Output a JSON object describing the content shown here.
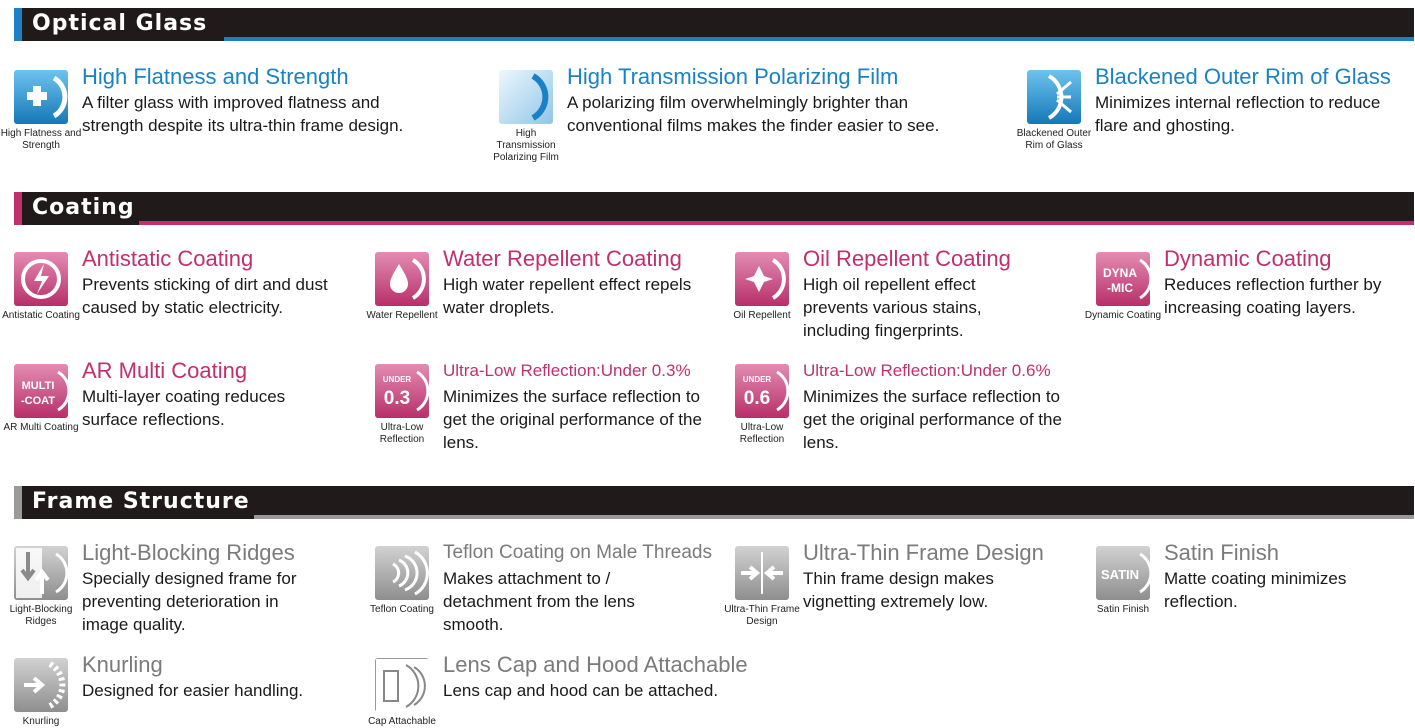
{
  "colors": {
    "blue": "#1a82c4",
    "pink": "#c0306e",
    "gray": "#7b7b7b",
    "bar": "#211a1a"
  },
  "sections": {
    "optical": {
      "title": "Optical Glass"
    },
    "coating": {
      "title": "Coating"
    },
    "frame": {
      "title": "Frame Structure"
    }
  },
  "optical_items": [
    {
      "icon": "cross-plus-icon",
      "caption": "High Flatness and Strength",
      "title": "High Flatness and Strength",
      "desc": "A filter glass with improved flatness and strength despite its ultra-thin frame design."
    },
    {
      "icon": "polarizing-film-icon",
      "caption": "High Transmission Polarizing Film",
      "title": "High Transmission Polarizing Film",
      "desc": "A polarizing film overwhelmingly brighter than conventional films makes the finder easier to see."
    },
    {
      "icon": "blackened-rim-icon",
      "caption": "Blackened Outer Rim of Glass",
      "title": "Blackened Outer Rim of Glass",
      "desc": "Minimizes internal reflection to reduce flare and ghosting."
    }
  ],
  "coating_items": [
    {
      "icon": "lightning-icon",
      "caption": "Antistatic Coating",
      "title": "Antistatic Coating",
      "desc": "Prevents sticking of dirt and dust caused by static electricity."
    },
    {
      "icon": "water-drop-icon",
      "caption": "Water Repellent",
      "title": "Water Repellent Coating",
      "desc": "High water repellent effect repels water droplets."
    },
    {
      "icon": "oil-drop-icon",
      "caption": "Oil Repellent",
      "title": "Oil Repellent Coating",
      "desc": "High oil repellent effect prevents various stains, including fingerprints."
    },
    {
      "icon": "dynamic-mic-icon",
      "icon_text": [
        "DYNA",
        "-MIC"
      ],
      "caption": "Dynamic Coating",
      "title": "Dynamic Coating",
      "desc": "Reduces reflection further by increasing coating layers."
    },
    {
      "icon": "multi-coat-icon",
      "icon_text": [
        "MULTI",
        "-COAT"
      ],
      "caption": "AR Multi Coating",
      "title": "AR Multi Coating",
      "desc": "Multi-layer coating reduces surface reflections."
    },
    {
      "icon": "under-03-icon",
      "icon_text": [
        "UNDER",
        "0.3"
      ],
      "caption": "Ultra-Low Reflection",
      "title": "Ultra-Low Reflection:Under 0.3%",
      "desc": "Minimizes the surface reflection to get the original performance of the lens."
    },
    {
      "icon": "under-06-icon",
      "icon_text": [
        "UNDER",
        "0.6"
      ],
      "caption": "Ultra-Low Reflection",
      "title": "Ultra-Low Reflection:Under 0.6%",
      "desc": "Minimizes the surface reflection to get the original performance of the lens."
    }
  ],
  "frame_items": [
    {
      "icon": "light-blocking-ridges-icon",
      "caption": "Light-Blocking Ridges",
      "title": "Light-Blocking Ridges",
      "desc": "Specially designed frame for preventing deterioration in image quality."
    },
    {
      "icon": "teflon-threads-icon",
      "caption": "Teflon Coating",
      "title": "Teflon Coating on Male Threads",
      "desc": "Makes attachment to / detachment from the lens smooth."
    },
    {
      "icon": "ultra-thin-frame-icon",
      "caption": "Ultra-Thin Frame Design",
      "title": "Ultra-Thin Frame Design",
      "desc": "Thin frame design makes vignetting extremely low."
    },
    {
      "icon": "satin-icon",
      "icon_text": [
        "SATIN"
      ],
      "caption": "Satin Finish",
      "title": "Satin Finish",
      "desc": "Matte coating minimizes reflection."
    },
    {
      "icon": "knurling-icon",
      "caption": "Knurling",
      "title": "Knurling",
      "desc": "Designed for easier handling."
    },
    {
      "icon": "cap-attachable-icon",
      "caption": "Cap Attachable",
      "title": "Lens Cap and Hood Attachable",
      "desc": "Lens cap and hood can be attached."
    }
  ]
}
